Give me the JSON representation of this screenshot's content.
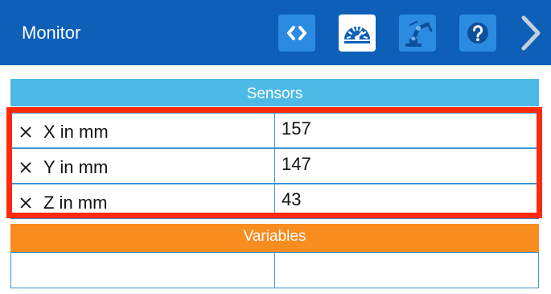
{
  "header": {
    "title": "Monitor",
    "buttons": [
      {
        "name": "code-view",
        "icon": "code-brackets-icon"
      },
      {
        "name": "monitor",
        "icon": "gauge-icon",
        "active": true
      },
      {
        "name": "robot",
        "icon": "robot-arm-icon"
      },
      {
        "name": "help",
        "icon": "question-icon"
      },
      {
        "name": "next",
        "icon": "chevron-right-icon"
      }
    ]
  },
  "sensors": {
    "title": "Sensors",
    "rows": [
      {
        "name": "X in mm",
        "value": "157"
      },
      {
        "name": "Y in mm",
        "value": "147"
      },
      {
        "name": "Z in mm",
        "value": "43"
      }
    ]
  },
  "variables": {
    "title": "Variables",
    "rows": [
      {
        "name": "",
        "value": ""
      }
    ]
  },
  "colors": {
    "header_bg": "#0d5fb8",
    "button_bg": "#2a8be0",
    "sensors_bg": "#4db9e6",
    "variables_bg": "#f98c1e",
    "highlight": "#ff2a0c",
    "cell_border": "#3b93d8"
  }
}
